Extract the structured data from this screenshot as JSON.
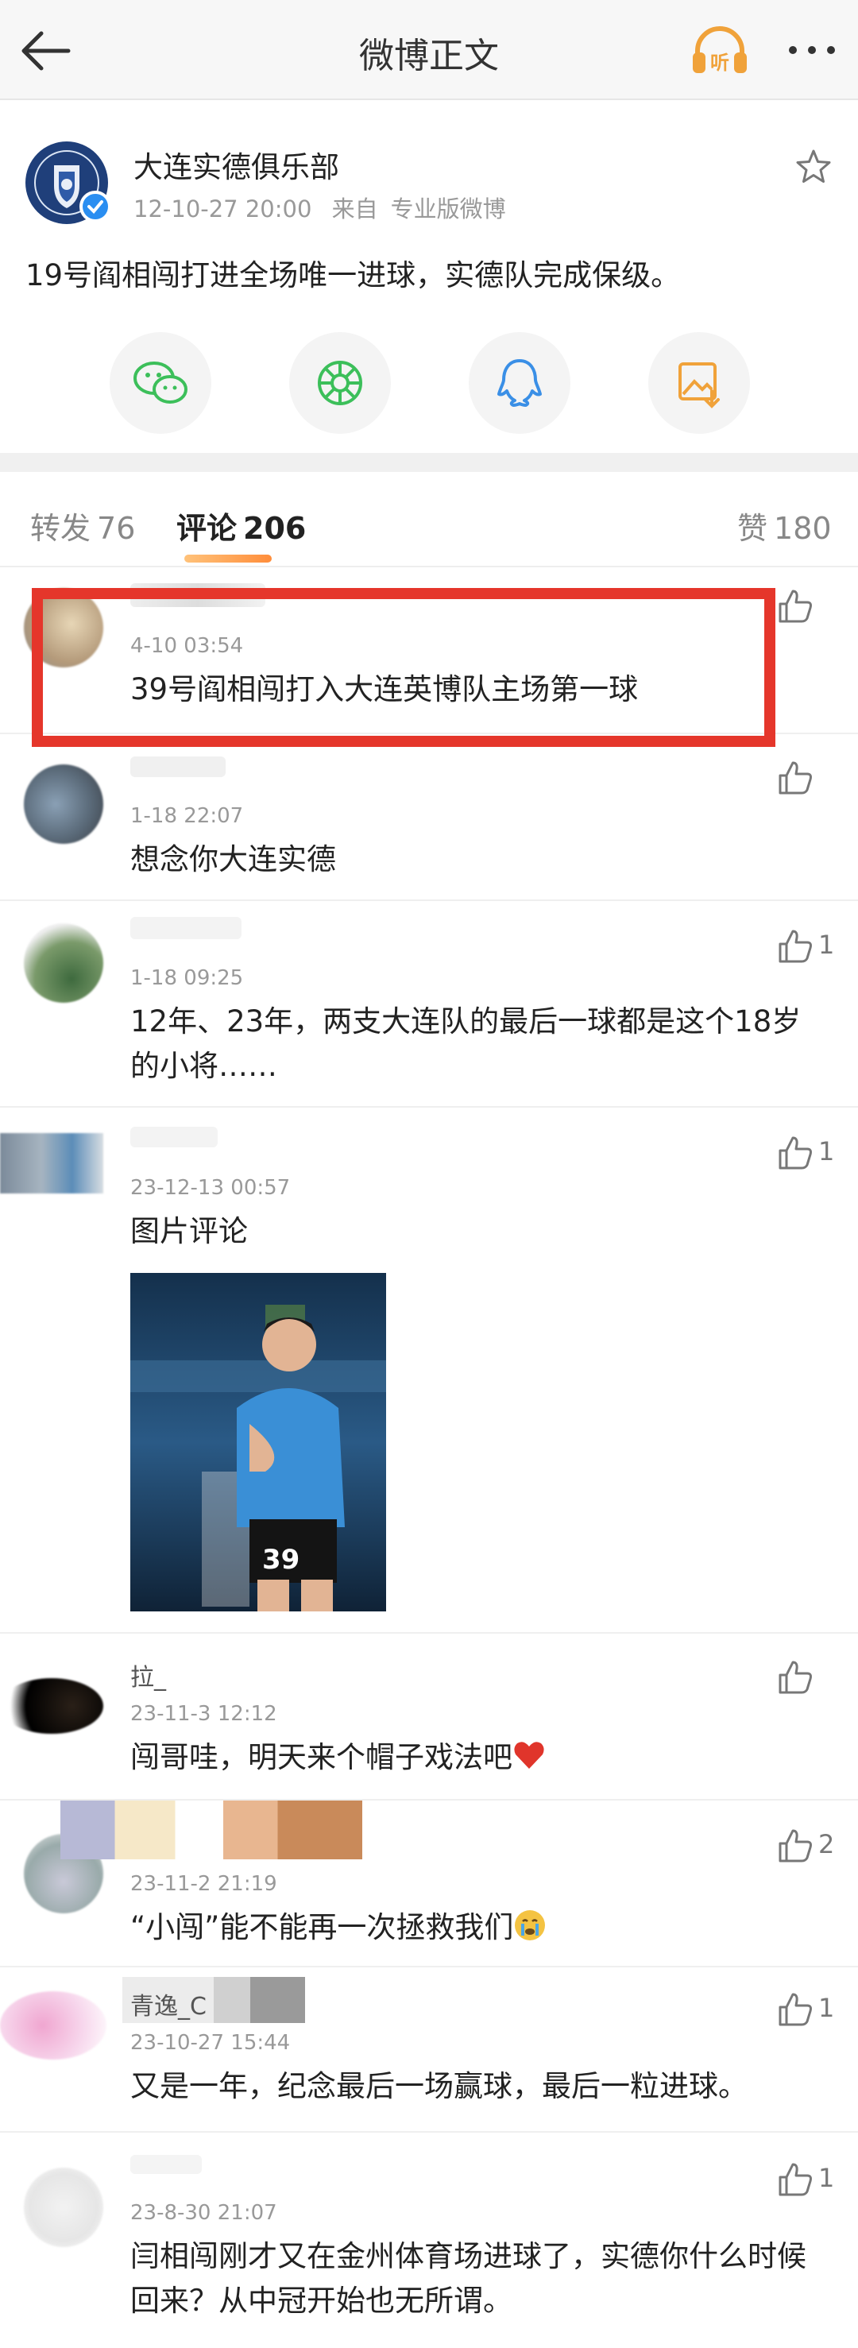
{
  "nav": {
    "title": "微博正文"
  },
  "post": {
    "author": "大连实德俱乐部",
    "time": "12-10-27 20:00",
    "source_prefix": "来自",
    "source": "专业版微博",
    "text": "19号阎相闯打进全场唯一进球，实德队完成保级。"
  },
  "tabs": {
    "repost_label": "转发",
    "repost_count": "76",
    "comment_label": "评论",
    "comment_count": "206",
    "like_label": "赞",
    "like_count": "180"
  },
  "comments": [
    {
      "time": "4-10 03:54",
      "text": "39号阎相闯打入大连英博队主场第一球",
      "likes": ""
    },
    {
      "time": "1-18 22:07",
      "text": "想念你大连实德",
      "likes": ""
    },
    {
      "time": "1-18 09:25",
      "text": "12年、23年，两支大连队的最后一球都是这个18岁的小将……",
      "likes": "1"
    },
    {
      "time": "23-12-13 00:57",
      "text": "图片评论",
      "likes": "1"
    },
    {
      "name": "拉_",
      "time": "23-11-3 12:12",
      "text": "闯哥哇，明天来个帽子戏法吧",
      "likes": ""
    },
    {
      "time": "23-11-2 21:19",
      "text": "“小闯”能不能再一次拯救我们",
      "likes": "2"
    },
    {
      "name": "青逸_C",
      "time": "23-10-27 15:44",
      "text": "又是一年，纪念最后一场赢球，最后一粒进球。",
      "likes": "1"
    },
    {
      "time": "23-8-30 21:07",
      "text": "闫相闯刚才又在金州体育场进球了，实德你什么时候回来？从中冠开始也无所谓。",
      "likes": "1"
    }
  ],
  "photo": {
    "jersey_number": "39"
  },
  "icons": {
    "back": "arrow-left-icon",
    "listen": "headphones-listen-icon",
    "listen_label": "听",
    "more": "more-dots-icon",
    "star": "star-icon",
    "share": [
      "wechat-icon",
      "moments-icon",
      "qq-icon",
      "save-image-icon"
    ],
    "like": "thumbs-up-icon"
  },
  "colors": {
    "accent_orange": "#ff8d3a",
    "highlight_red": "#e5362b",
    "share_icon_green": "#3cbf5a",
    "share_icon_blue": "#3a8fe6",
    "share_icon_orange": "#f0a23a",
    "heart": "#e0352b"
  }
}
